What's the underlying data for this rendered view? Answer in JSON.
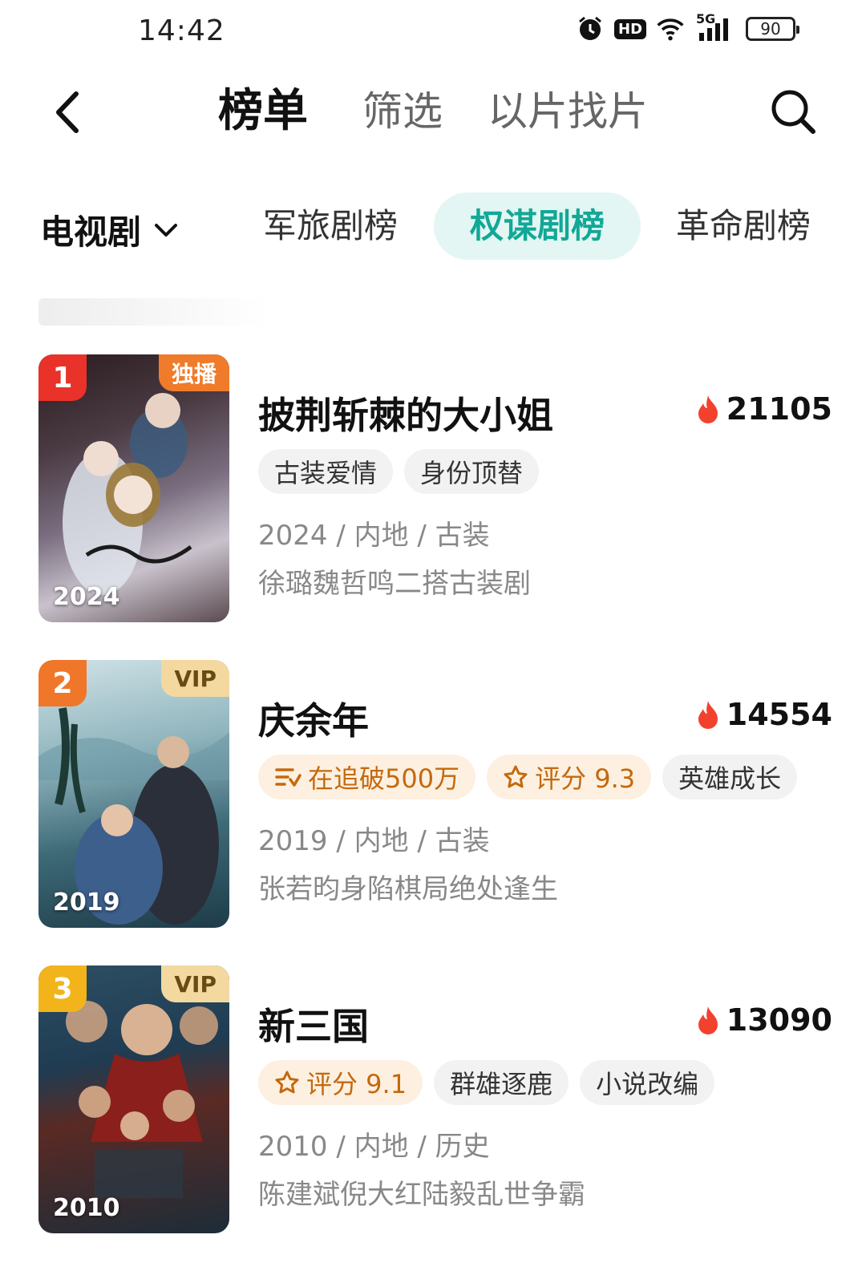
{
  "status_bar": {
    "time": "14:42",
    "hd": "HD",
    "network": "5G",
    "battery": "90"
  },
  "header": {
    "tab_rank": "榜单",
    "tab_filter": "筛选",
    "tab_search_by_image": "以片找片"
  },
  "categories": {
    "selected": "电视剧",
    "tabs": [
      "军旅剧榜",
      "权谋剧榜",
      "革命剧榜"
    ],
    "active_tab": "权谋剧榜"
  },
  "colors": {
    "accent": "#12a896",
    "accent_bg": "#e3f6f3",
    "heat": "#f2422e"
  },
  "items": [
    {
      "rank": "1",
      "corner_tag": "独播",
      "poster_year": "2024",
      "title": "披荆斩棘的大小姐",
      "heat": "21105",
      "chips": [
        {
          "label": "古装爱情",
          "icon": ""
        },
        {
          "label": "身份顶替",
          "icon": ""
        }
      ],
      "meta": "2024 / 内地 / 古装",
      "desc": "徐璐魏哲鸣二搭古装剧"
    },
    {
      "rank": "2",
      "corner_tag": "VIP",
      "poster_year": "2019",
      "title": "庆余年",
      "heat": "14554",
      "chips": [
        {
          "label": "在追破500万",
          "icon": "list-icon"
        },
        {
          "label": "评分 9.3",
          "icon": "star-icon"
        },
        {
          "label": "英雄成长",
          "icon": ""
        }
      ],
      "meta": "2019 / 内地 / 古装",
      "desc": "张若昀身陷棋局绝处逢生"
    },
    {
      "rank": "3",
      "corner_tag": "VIP",
      "poster_year": "2010",
      "title": "新三国",
      "heat": "13090",
      "chips": [
        {
          "label": "评分 9.1",
          "icon": "star-icon"
        },
        {
          "label": "群雄逐鹿",
          "icon": ""
        },
        {
          "label": "小说改编",
          "icon": ""
        }
      ],
      "meta": "2010 / 内地 / 历史",
      "desc": "陈建斌倪大红陆毅乱世争霸"
    }
  ]
}
